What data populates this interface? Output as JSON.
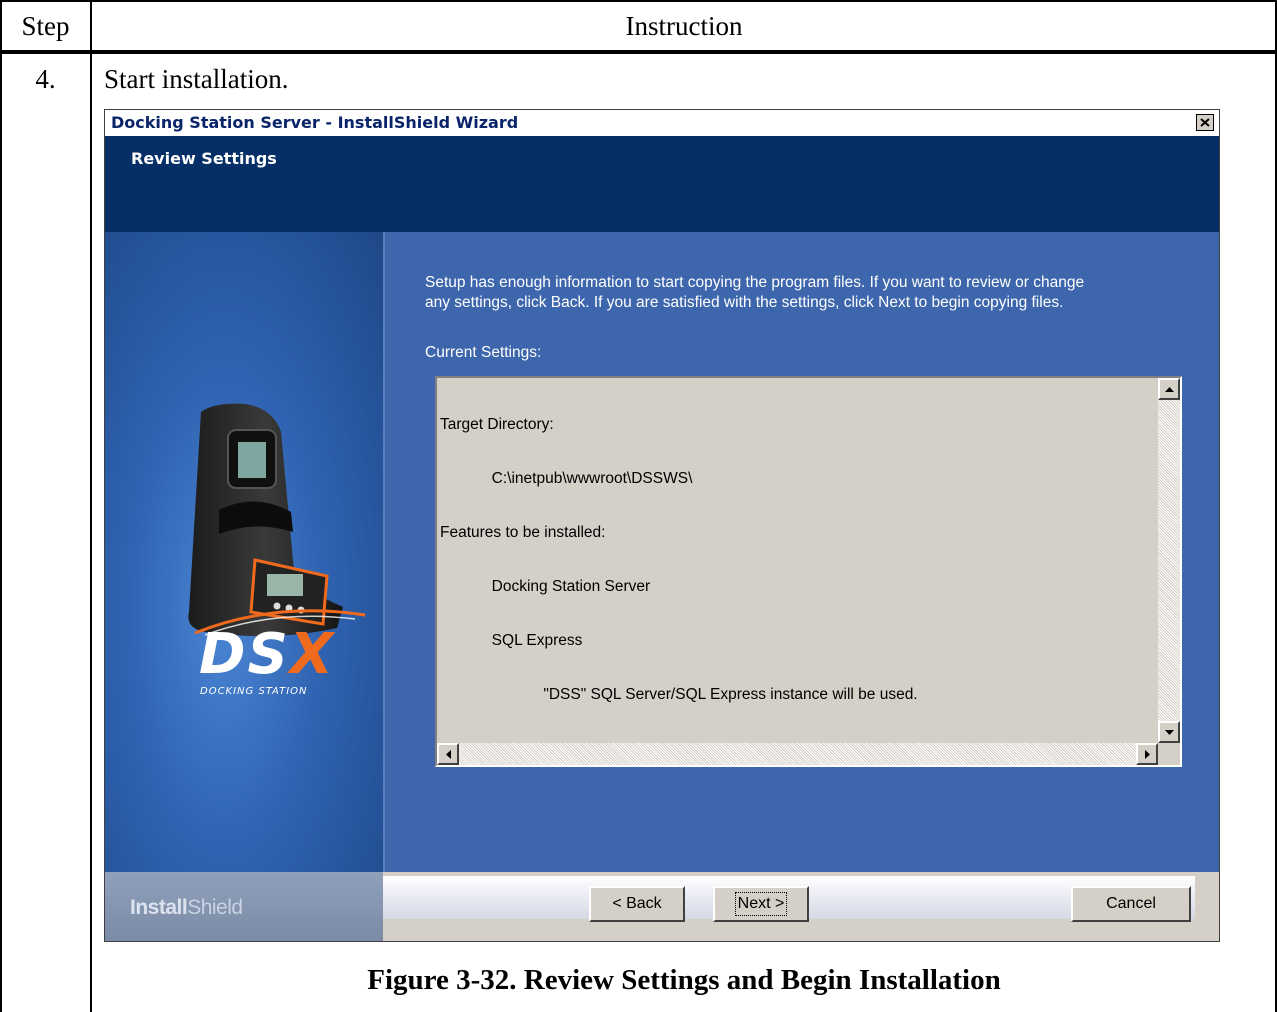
{
  "table": {
    "step_header": "Step",
    "instruction_header": "Instruction",
    "step_number": "4.",
    "step_text": "Start installation.",
    "caption": "Figure 3-32.  Review Settings and Begin Installation"
  },
  "wizard": {
    "title": "Docking Station Server - InstallShield Wizard",
    "banner_title": "Review Settings",
    "description_line1": "Setup has enough information to start copying the program files.  If you want to review or change",
    "description_line2": "any settings, click Back.  If you are satisfied with the settings, click Next to begin copying files.",
    "current_settings_label": "Current Settings:",
    "settings_lines": [
      "Target Directory:",
      "            C:\\inetpub\\wwwroot\\DSSWS\\",
      "Features to be installed:",
      "            Docking Station Server",
      "            SQL Express",
      "                        \"DSS\" SQL Server/SQL Express instance will be used."
    ],
    "logo_text": "DSX",
    "logo_subtext": "DOCKING STATION",
    "brand_bold": "Install",
    "brand_light": "Shield",
    "buttons": {
      "back": "< Back",
      "next": "Next >",
      "cancel": "Cancel"
    },
    "colors": {
      "title_text": "#0a246a",
      "banner": "#062f67",
      "content_bg": "#3d66ac",
      "logo_orange": "#f06a1e"
    }
  }
}
